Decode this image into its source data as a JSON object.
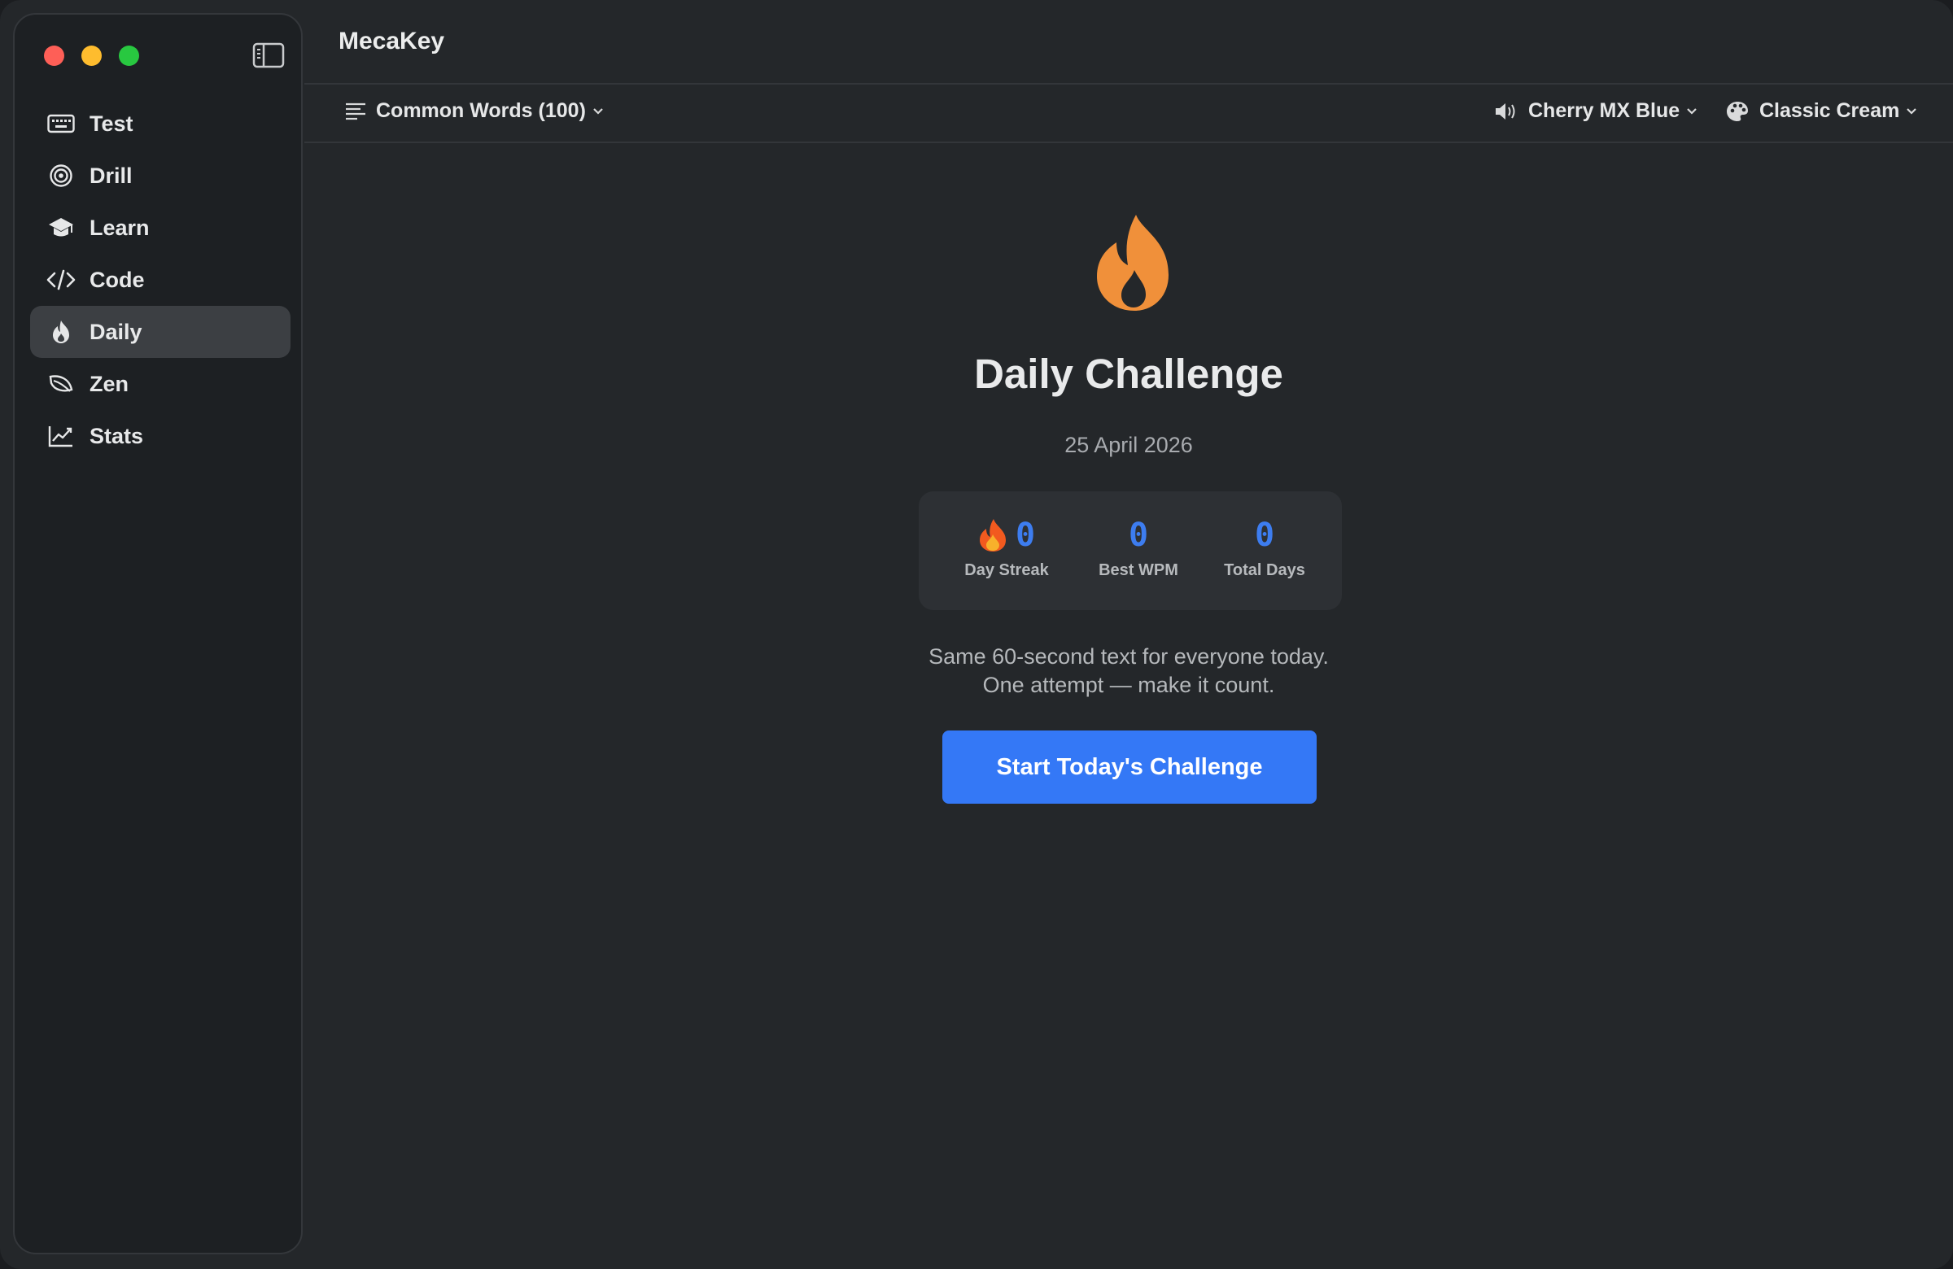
{
  "window": {
    "title": "MecaKey"
  },
  "sidebar": {
    "items": [
      {
        "label": "Test",
        "icon": "keyboard-icon",
        "active": false
      },
      {
        "label": "Drill",
        "icon": "target-icon",
        "active": false
      },
      {
        "label": "Learn",
        "icon": "graduation-cap-icon",
        "active": false
      },
      {
        "label": "Code",
        "icon": "code-icon",
        "active": false
      },
      {
        "label": "Daily",
        "icon": "flame-icon",
        "active": true
      },
      {
        "label": "Zen",
        "icon": "leaf-icon",
        "active": false
      },
      {
        "label": "Stats",
        "icon": "chart-line-icon",
        "active": false
      }
    ]
  },
  "toolbar": {
    "word_list": "Common Words (100)",
    "sound": "Cherry MX Blue",
    "theme": "Classic Cream"
  },
  "daily": {
    "title": "Daily Challenge",
    "date": "25 April 2026",
    "stats": [
      {
        "value": "0",
        "label": "Day Streak"
      },
      {
        "value": "0",
        "label": "Best WPM"
      },
      {
        "value": "0",
        "label": "Total Days"
      }
    ],
    "description_line1": "Same 60-second text for everyone today.",
    "description_line2": "One attempt — make it count.",
    "start_button": "Start Today's Challenge"
  },
  "colors": {
    "accent": "#3478f6",
    "stat_number": "#3d7df0",
    "flame": "#f0903a",
    "active_item_bg": "#3c3f43"
  }
}
